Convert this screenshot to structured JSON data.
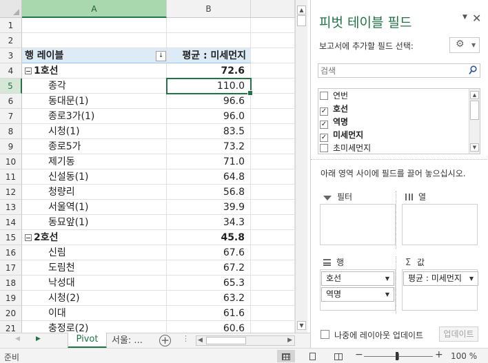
{
  "sheet": {
    "columns": [
      "A",
      "B"
    ],
    "row_numbers": [
      "1",
      "2",
      "3",
      "4",
      "5",
      "6",
      "7",
      "8",
      "9",
      "10",
      "11",
      "12",
      "13",
      "14",
      "15",
      "16",
      "17",
      "18",
      "19",
      "20",
      "21"
    ],
    "pivot_header": {
      "row_label": "행 레이블",
      "value_label": "평균 : 미세먼지",
      "filter_glyph": "↓"
    },
    "rows": [
      {
        "label": "1호선",
        "value": "72.6",
        "type": "group"
      },
      {
        "label": "종각",
        "value": "110.0",
        "type": "item"
      },
      {
        "label": "동대문(1)",
        "value": "96.6",
        "type": "item"
      },
      {
        "label": "종로3가(1)",
        "value": "96.0",
        "type": "item"
      },
      {
        "label": "시청(1)",
        "value": "83.5",
        "type": "item"
      },
      {
        "label": "종로5가",
        "value": "73.2",
        "type": "item"
      },
      {
        "label": "제기동",
        "value": "71.0",
        "type": "item"
      },
      {
        "label": "신설동(1)",
        "value": "64.8",
        "type": "item"
      },
      {
        "label": "청량리",
        "value": "56.8",
        "type": "item"
      },
      {
        "label": "서울역(1)",
        "value": "39.9",
        "type": "item"
      },
      {
        "label": "동묘앞(1)",
        "value": "34.3",
        "type": "item"
      },
      {
        "label": "2호선",
        "value": "45.8",
        "type": "group"
      },
      {
        "label": "신림",
        "value": "67.6",
        "type": "item"
      },
      {
        "label": "도림천",
        "value": "67.2",
        "type": "item"
      },
      {
        "label": "낙성대",
        "value": "65.3",
        "type": "item"
      },
      {
        "label": "시청(2)",
        "value": "63.2",
        "type": "item"
      },
      {
        "label": "이대",
        "value": "61.6",
        "type": "item"
      },
      {
        "label": "충정로(2)",
        "value": "60.6",
        "type": "item"
      }
    ]
  },
  "tabs": {
    "active": "Pivot",
    "second": "서울: ...",
    "add_glyph": "+",
    "dots": "⋮"
  },
  "status": {
    "text": "준비",
    "zoom": "100 %",
    "minus": "−",
    "plus": "+"
  },
  "pane": {
    "title": "피벗 테이블 필드",
    "menu_glyph": "▼",
    "close_glyph": "✕",
    "subtitle": "보고서에 추가할 필드 선택:",
    "search_placeholder": "검색",
    "fields": [
      {
        "name": "연번",
        "checked": false
      },
      {
        "name": "호선",
        "checked": true
      },
      {
        "name": "역명",
        "checked": true
      },
      {
        "name": "미세먼지",
        "checked": true
      },
      {
        "name": "초미세먼지",
        "checked": false
      }
    ],
    "drag_hint": "아래 영역 사이에 필드를 끌어 놓으십시오.",
    "areas": {
      "filters": "필터",
      "columns": "열",
      "rows": "행",
      "values": "값"
    },
    "row_fields": [
      "호선",
      "역명"
    ],
    "value_fields": [
      "평균 : 미세먼지"
    ],
    "defer_label": "나중에 레이아웃 업데이트",
    "update_button": "업데이트"
  },
  "colors": {
    "accent": "#217346",
    "header_fill": "#ddebf7",
    "selected_col": "#a9d7ae"
  }
}
